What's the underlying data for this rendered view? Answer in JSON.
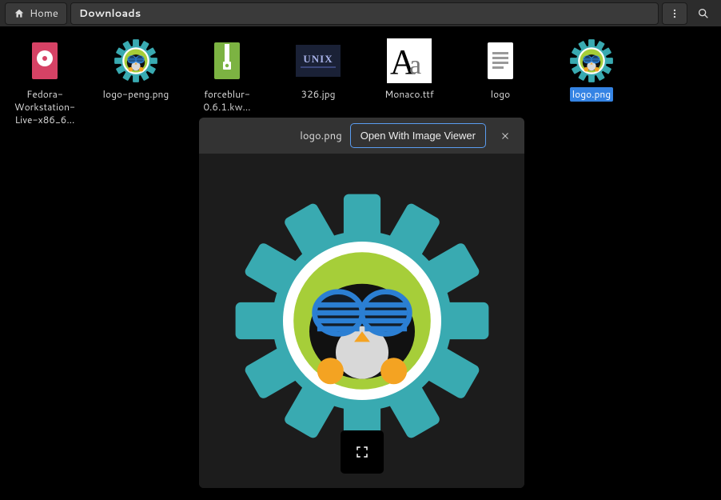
{
  "toolbar": {
    "home_label": "Home",
    "path": "Downloads"
  },
  "files": [
    {
      "label": "Fedora-Workstation-Live-x86_6…",
      "icon": "iso",
      "selected": false
    },
    {
      "label": "logo-peng.png",
      "icon": "gearpenguin",
      "selected": false
    },
    {
      "label": "forceblur-0.6.1.kw…",
      "icon": "archive",
      "selected": false
    },
    {
      "label": "326.jpg",
      "icon": "unix-jpg",
      "selected": false
    },
    {
      "label": "Monaco.ttf",
      "icon": "font",
      "selected": false
    },
    {
      "label": "logo",
      "icon": "textdoc",
      "selected": false
    },
    {
      "label": "logo.png",
      "icon": "gearpenguin",
      "selected": true
    }
  ],
  "preview": {
    "title": "logo.png",
    "open_label": "Open With Image Viewer"
  }
}
